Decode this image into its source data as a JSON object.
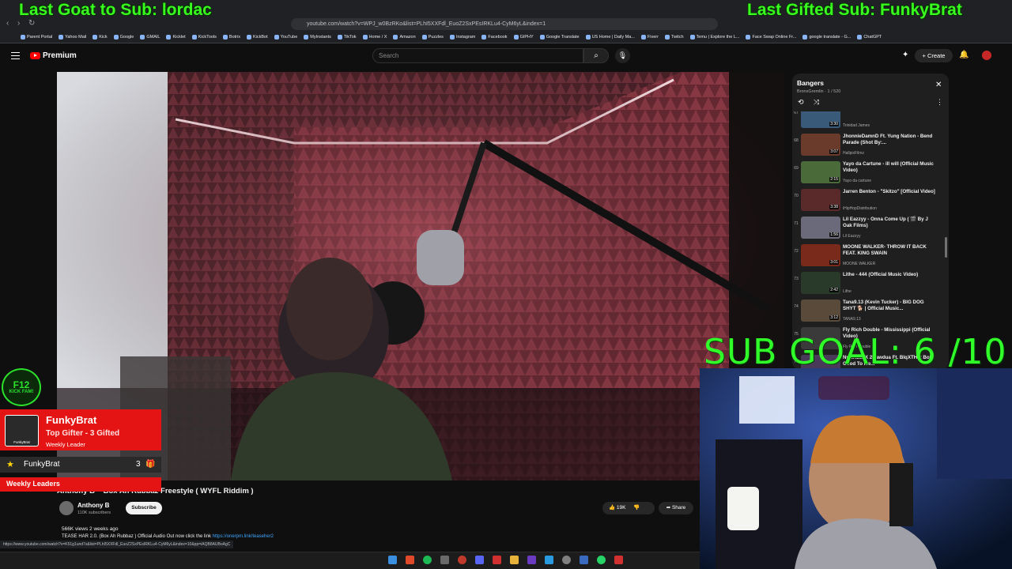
{
  "overlay": {
    "left_text": "Last Goat to Sub: lordac",
    "right_text": "Last Gifted Sub: FunkyBrat",
    "sub_goal": "SUB GOAL: 6 /10"
  },
  "browser": {
    "url": "youtube.com/watch?v=WPJ_w0BzRKo&list=PLhI5XXFdl_EuoZ2SxPEsIRKLu4-CyM6yL&index=1",
    "status_url": "https://www.youtube.com/watch?v=K51g1und7s&list=PLhI5XXFdl_EuoZ2SxPEsIRKLu4-CyM6yL&index=10&pp=iAQB8AUBoAgC",
    "bookmarks": [
      "Parent Portal",
      "Yahoo Mail",
      "Kick",
      "Google",
      "GMAIL",
      "Kicklet",
      "KickTools",
      "Botrix",
      "KickBot",
      "YouTube",
      "MyInstants",
      "TikTok",
      "Home / X",
      "Amazon",
      "Puzzles",
      "Instagram",
      "Facebook",
      "GIPHY",
      "Google Translate",
      "US Home | Daily Ma...",
      "Fiverr",
      "Twitch",
      "Temu | Explore the L...",
      "Face Swap Online Fr...",
      "google translate - G...",
      "ChatGPT"
    ]
  },
  "header": {
    "brand": "Premium",
    "search_placeholder": "Search",
    "create_label": "Create"
  },
  "video": {
    "title": "Anthony B – Box Ah Rubbaz Freestyle ( WYFL Riddim )",
    "channel": "Anthony B",
    "subscribers": "110K subscribers",
    "subscribe_label": "Subscribe",
    "likes": "19K",
    "share_label": "Share",
    "meta": "566K views  2 weeks ago",
    "desc_text": "TEASE HAR 2.0. (Box Ah Rubbaz ) Official Audio Out now click the link ",
    "desc_link": "https://onerpm.link/teaseher2"
  },
  "playlist": {
    "title": "Bangers",
    "owner_progress": "BronxGremlin · 1 / 520",
    "items": [
      {
        "index": "67",
        "title": "(Official Music Video)",
        "channel": "Trinidad James",
        "duration": "3:30",
        "color": "#3a5a7a"
      },
      {
        "index": "68",
        "title": "JhonnieDamnD Ft. Yung Nation - Bend Parade (Shot By:...",
        "channel": "HallpixFilmz",
        "duration": "3:07",
        "color": "#6a3a2a"
      },
      {
        "index": "69",
        "title": "Yayo da Cartune - ill will (Official Music Video)",
        "channel": "Yayo da cartune",
        "duration": "2:15",
        "color": "#4a6a3a"
      },
      {
        "index": "70",
        "title": "Jarren Benton - \"Skitzo\" [Official Video]",
        "channel": "iHipHopDistribution",
        "duration": "3:38",
        "color": "#5a2a2a"
      },
      {
        "index": "71",
        "title": "Lil Eazzyy - Onna Come Up ( 🎬 By J Oak Films)",
        "channel": "Lil Eazzyy",
        "duration": "1:56",
        "color": "#6a6a7a"
      },
      {
        "index": "72",
        "title": "MOONE WALKER- THROW IT BACK FEAT. KING SWAIN",
        "channel": "MOONE WALKER",
        "duration": "3:01",
        "color": "#7a2a1a"
      },
      {
        "index": "73",
        "title": "Lithe - 444 (Official Music Video)",
        "channel": "Lithe",
        "duration": "2:42",
        "color": "#2a3a2a"
      },
      {
        "index": "74",
        "title": "Tana9.13 (Kevin Tucker) - BIG DOG SHYT 🐕 | Official Music...",
        "channel": "TANA9.13",
        "duration": "3:12",
        "color": "#5a4a3a"
      },
      {
        "index": "75",
        "title": "Fly Rich Double - Mississippi (Official Video)",
        "channel": "Fly Rich Double",
        "duration": "",
        "color": "#3a3a3a"
      },
      {
        "index": "76",
        "title": "NyKRushX 2Rawdua Ft. BlqXTHat Boi - Good To Me...",
        "channel": "",
        "duration": "",
        "color": "#4a3a5a"
      }
    ]
  },
  "alerts": {
    "badge_top": "F12",
    "badge_mid": "KICK FAM!",
    "gifter_name": "FunkyBrat",
    "gifter_line": "Top Gifter - 3 Gifted",
    "gifter_week": "Weekly Leader",
    "avatar_caption": "FunkyBrat",
    "leader_name": "FunkyBrat",
    "leader_count": "3",
    "weekly_label": "Weekly Leaders"
  },
  "colors": {
    "accent": "#3bff1f",
    "alert_red": "#e51414",
    "yt_red": "#ff0000"
  }
}
